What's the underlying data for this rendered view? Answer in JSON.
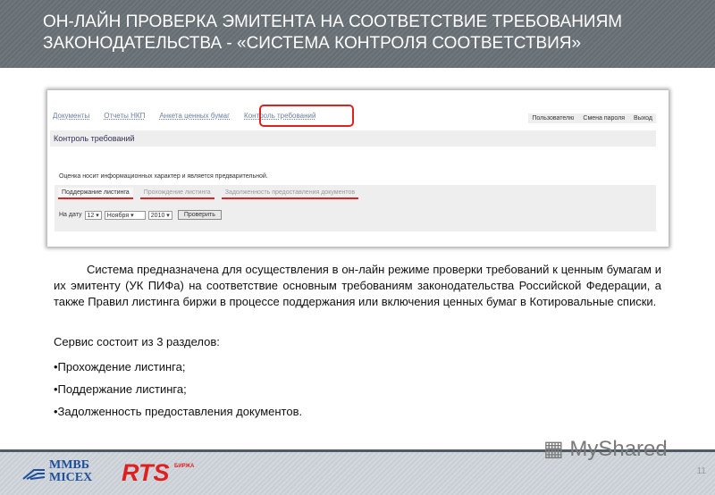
{
  "header": {
    "line1": "ОН-ЛАЙН ПРОВЕРКА ЭМИТЕНТА НА СООТВЕТСТВИЕ ТРЕБОВАНИЯМ",
    "line2": "ЗАКОНОДАТЕЛЬСТВА  - «СИСТЕМА КОНТРОЛЯ СООТВЕТСТВИЯ»"
  },
  "screenshot": {
    "nav": [
      "Документы",
      "Отчеты НКП",
      "Анкета ценных бумаг",
      "Контроль требований"
    ],
    "user_menu": [
      "Пользователю",
      "Смена пароля",
      "Выход"
    ],
    "section_title": "Контроль требований",
    "note": "Оценка носит информационных характер и является предварительной.",
    "tabs": [
      "Поддержание листинга",
      "Прохождение листинга",
      "Задолженность предоставления документов"
    ],
    "form": {
      "date_label": "На дату",
      "day": "12",
      "month": "Ноября",
      "year": "2010",
      "check_button": "Проверить"
    }
  },
  "body": {
    "paragraph": "Система предназначена для осуществления в он-лайн режиме проверки требований к ценным бумагам и их эмитенту (УК ПИФа) на соответствие основным требованиям законодательства Российской Федерации, а также Правил листинга биржи в процессе поддержания или включения ценных бумаг в Котировальные списки.",
    "sections_intro": "Сервис состоит из 3 разделов:",
    "items": [
      "•Прохождение листинга;",
      "•Поддержание листинга;",
      "•Задолженность предоставления документов."
    ]
  },
  "footer": {
    "micex_line1": "ММВБ",
    "micex_line2": "MICEX",
    "rts": "RTS",
    "birzha": "БИРЖА",
    "watermark": "MyShared",
    "page_number": "11"
  }
}
